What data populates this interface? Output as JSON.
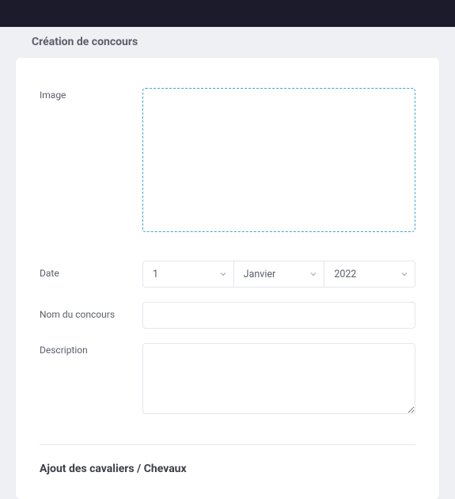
{
  "page": {
    "title": "Création de concours"
  },
  "form": {
    "image": {
      "label": "Image"
    },
    "date": {
      "label": "Date",
      "day": "1",
      "month": "Janvier",
      "year": "2022"
    },
    "name": {
      "label": "Nom du concours",
      "value": ""
    },
    "description": {
      "label": "Description",
      "value": ""
    }
  },
  "sections": {
    "riders": "Ajout des cavaliers / Chevaux"
  }
}
